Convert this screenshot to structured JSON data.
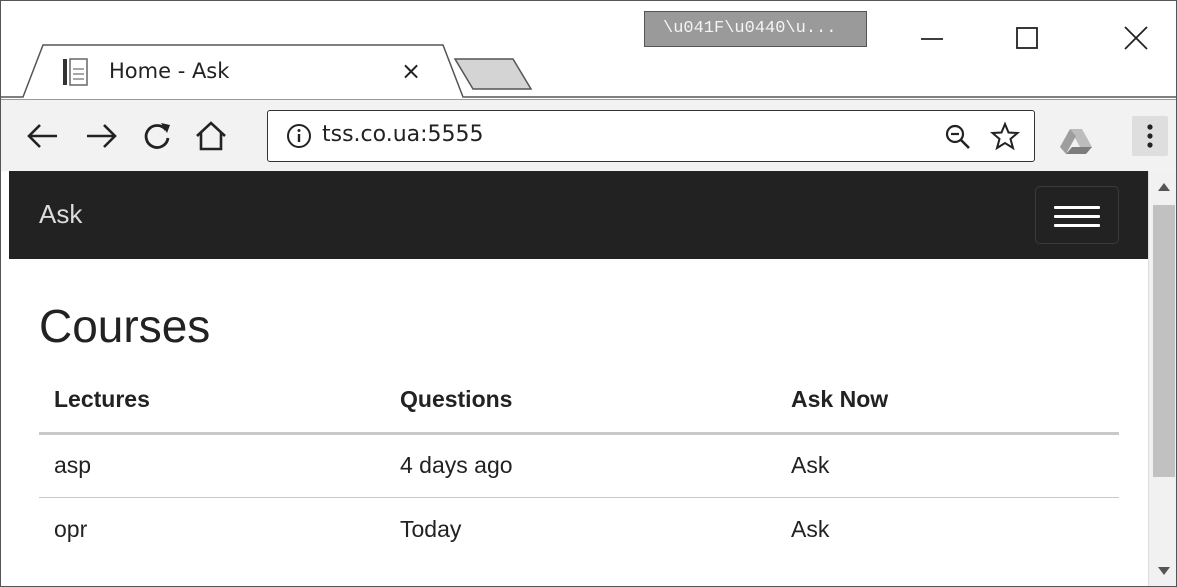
{
  "browser": {
    "tab": {
      "title": "Home - Ask",
      "close": "×"
    },
    "title_overlay": "\\u041F\\u0440\\u...",
    "address_bar": {
      "url": "tss.co.ua:5555"
    }
  },
  "page": {
    "navbar": {
      "brand": "Ask"
    },
    "title": "Courses",
    "table": {
      "headers": [
        "Lectures",
        "Questions",
        "Ask Now"
      ],
      "rows": [
        [
          "asp",
          "4 days ago",
          "Ask"
        ],
        [
          "opr",
          "Today",
          "Ask"
        ]
      ]
    }
  },
  "colors": {
    "navbar_bg": "#222222",
    "toolbar_bg": "#f2f2f2",
    "overlay_bg": "#9a9a9a"
  },
  "icons": [
    "page-icon",
    "back-arrow-icon",
    "forward-arrow-icon",
    "reload-icon",
    "home-icon",
    "info-icon",
    "zoom-out-icon",
    "star-icon",
    "drive-icon",
    "more-menu-icon",
    "minimize-icon",
    "maximize-icon",
    "close-icon",
    "hamburger-icon"
  ]
}
